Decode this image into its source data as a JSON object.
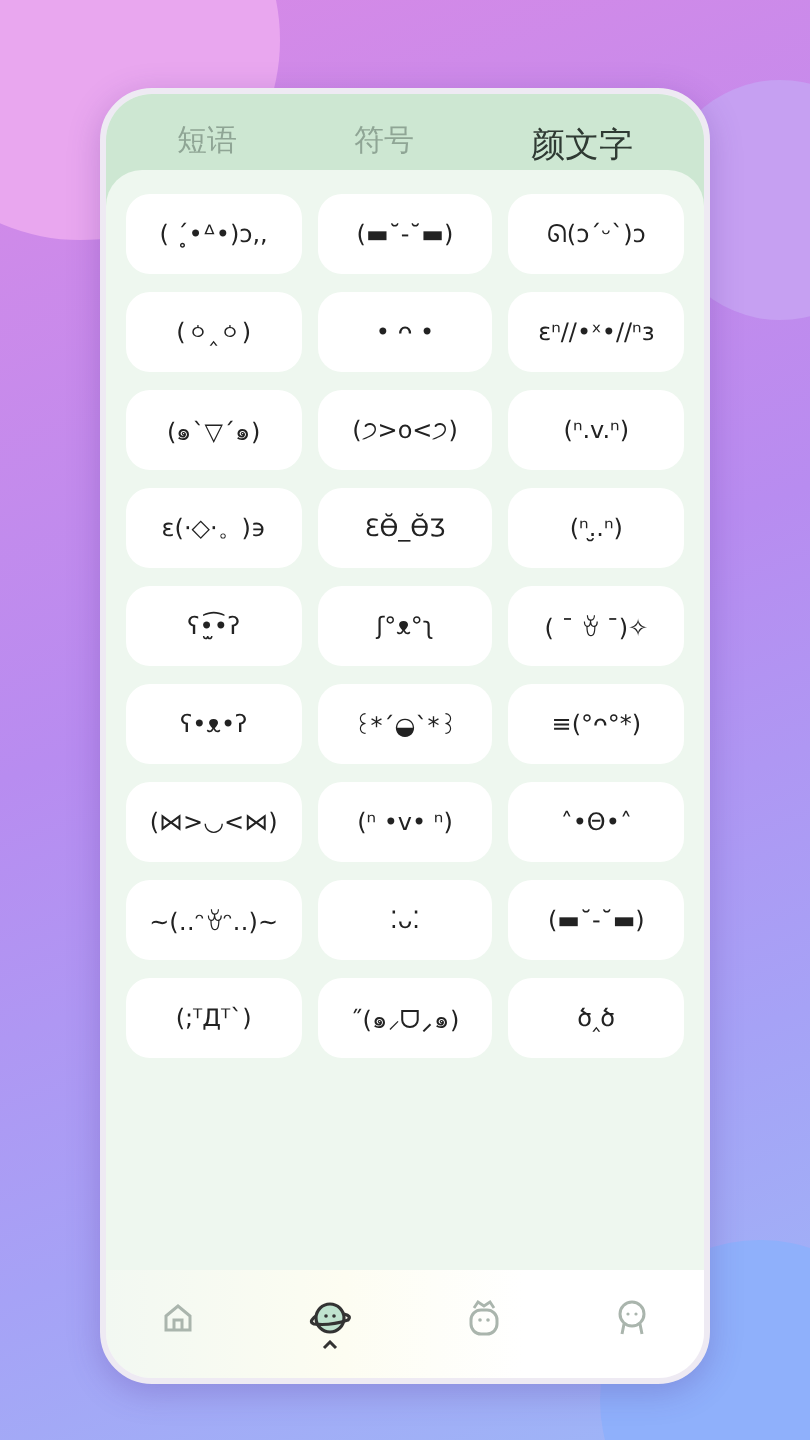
{
  "tabs": [
    {
      "label": "短语",
      "selected": false
    },
    {
      "label": "符号",
      "selected": false
    },
    {
      "label": "颜文字",
      "selected": true
    }
  ],
  "kaomoji": [
    "( ˊ̥•ᐞ•)ɔ,,",
    "(▬˘-˘▬)",
    "ᘏ(ɔˊᵕˋ)ɔ",
    "(ㆁ‸ㆁ)",
    "• ᴖ •",
    "εⁿ//•ˣ•//ⁿз",
    "(๑`▽´๑)",
    "(੭>o<੭)",
    "(ⁿ.v.ⁿ)",
    "ε(·◇·。)϶",
    "ƐӨ̆_Ө̆Ʒ",
    "(ⁿ.̮.ⁿ)",
    "ʕ•̫͡•ʔ",
    "ʃ°ᴥ°ʅ",
    "( ¯ ꈊ ¯)✧",
    "ʕ•ᴥ•ʔ",
    "꒰*´◒`*꒱",
    "≡(°ᴖ°*)",
    "(⋈>◡<⋈)",
    "(ⁿ •v• ⁿ)",
    "˄•Θ•˄",
    "~(‥ᵔꈊᵔ‥)~",
    "⁚ᴗ⁚",
    "(▬˘-˘▬)",
    "(;ᵀДᵀ`)",
    "˝(๑⸝ᗜ⸝๑)",
    "ծ‸ծ"
  ],
  "nav": [
    {
      "kind": "home",
      "selected": false
    },
    {
      "kind": "planet",
      "selected": true
    },
    {
      "kind": "crown",
      "selected": false
    },
    {
      "kind": "face",
      "selected": false
    }
  ]
}
